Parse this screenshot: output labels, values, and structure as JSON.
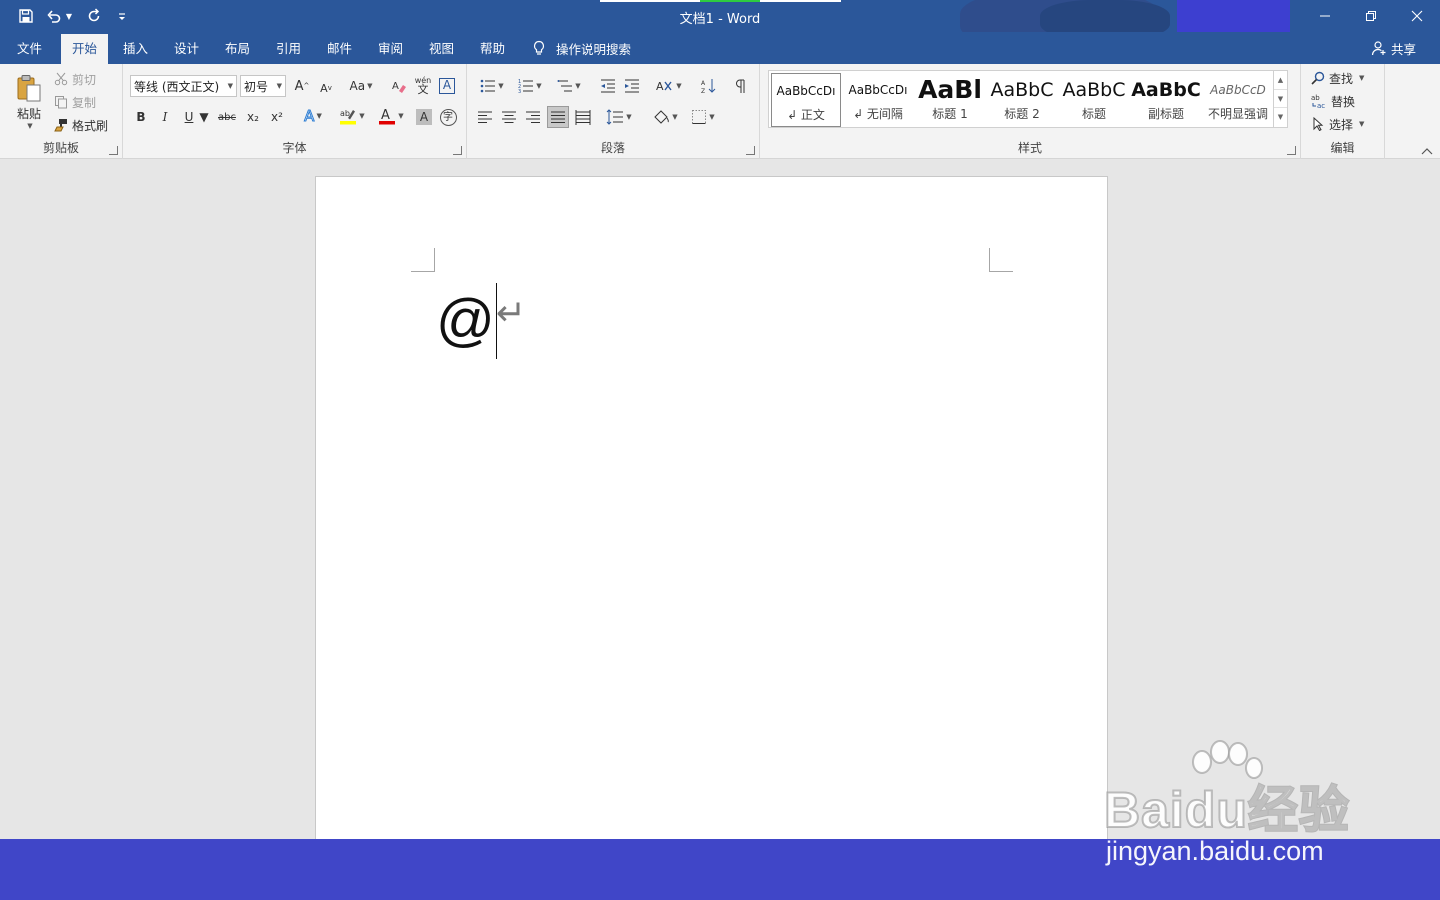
{
  "window": {
    "title": "文档1  -  Word",
    "accent_color": "#2b579a",
    "controls": [
      "minimize-icon",
      "restore-icon",
      "close-icon"
    ]
  },
  "quick_access": {
    "icons": [
      "save-icon",
      "undo-icon",
      "redo-icon",
      "customize-icon"
    ]
  },
  "menu": {
    "tabs": [
      {
        "label": "文件"
      },
      {
        "label": "开始",
        "active": true
      },
      {
        "label": "插入"
      },
      {
        "label": "设计"
      },
      {
        "label": "布局"
      },
      {
        "label": "引用"
      },
      {
        "label": "邮件"
      },
      {
        "label": "审阅"
      },
      {
        "label": "视图"
      },
      {
        "label": "帮助"
      }
    ],
    "tell_me": "操作说明搜索",
    "share": "共享"
  },
  "ribbon": {
    "clipboard": {
      "label": "剪贴板",
      "paste": "粘贴",
      "cut": "剪切",
      "copy": "复制",
      "format_painter": "格式刷"
    },
    "font": {
      "label": "字体",
      "font_name": "等线 (西文正文)",
      "font_size": "初号",
      "bold": "B",
      "italic": "I",
      "underline": "U",
      "strikethrough": "abc",
      "subscript": "x₂",
      "superscript": "x²",
      "change_case": "Aa",
      "grow_font": "A",
      "shrink_font": "A",
      "phonetic": "wén"
    },
    "paragraph": {
      "label": "段落"
    },
    "styles": {
      "label": "样式",
      "items": [
        {
          "preview": "AaBbCcDı",
          "name": "↲ 正文",
          "selected": true
        },
        {
          "preview": "AaBbCcDı",
          "name": "↲ 无间隔"
        },
        {
          "preview": "AaBl",
          "name": "标题 1"
        },
        {
          "preview": "AaBbC",
          "name": "标题 2"
        },
        {
          "preview": "AaBbC",
          "name": "标题"
        },
        {
          "preview": "AaBbC",
          "name": "副标题"
        },
        {
          "preview": "AaBbCcD",
          "name": "不明显强调"
        }
      ]
    },
    "editing": {
      "label": "编辑",
      "find": "查找",
      "replace": "替换",
      "select": "选择"
    }
  },
  "document": {
    "text": "@",
    "return_mark": "↵"
  },
  "watermark": {
    "logo": "Baidu经验",
    "url": "jingyan.baidu.com"
  },
  "colors": {
    "bottom_bar": "#4046c8",
    "font_color_bar": "#e00000",
    "highlight_bar": "#ffff00"
  }
}
